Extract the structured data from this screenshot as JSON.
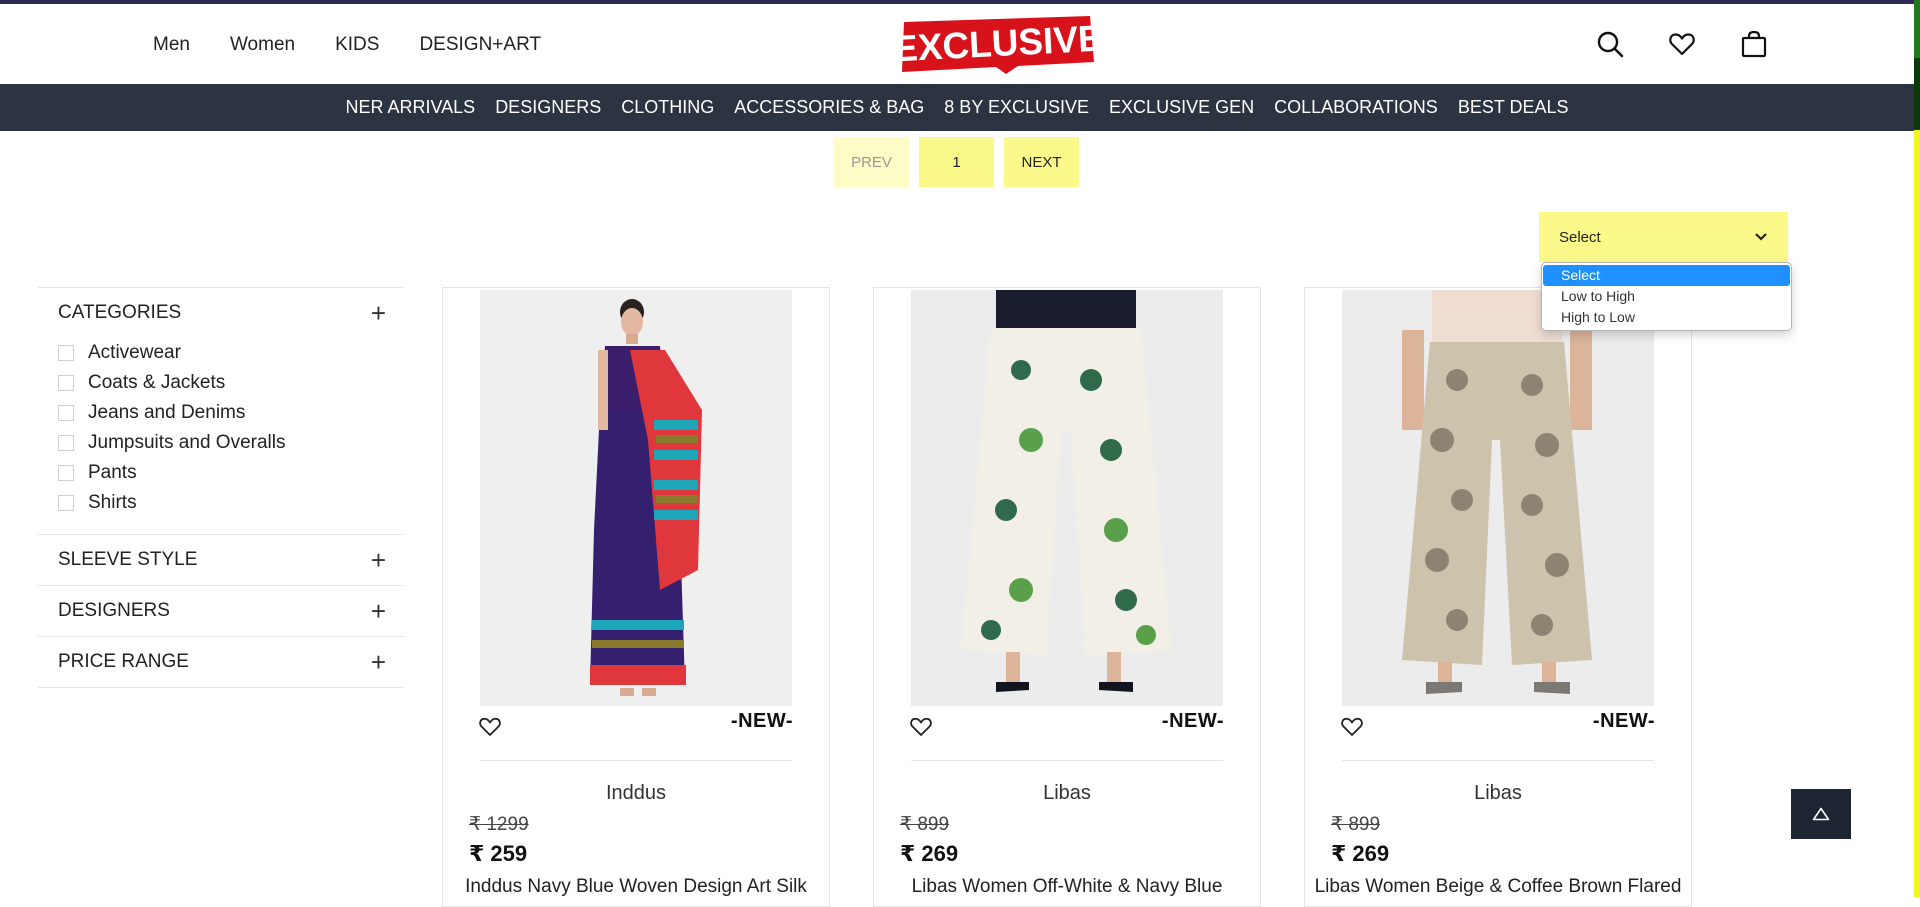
{
  "header": {
    "nav": [
      "Men",
      "Women",
      "KIDS",
      "DESIGN+ART"
    ],
    "logo_text": "EXCLUSIVE",
    "icons": [
      "search-icon",
      "heart-icon",
      "shopping-bag-icon"
    ]
  },
  "category_bar": [
    "NER ARRIVALS",
    "DESIGNERS",
    "CLOTHING",
    "ACCESSORIES & BAG",
    "8 BY EXCLUSIVE",
    "EXCLUSIVE GEN",
    "COLLABORATIONS",
    "BEST DEALS"
  ],
  "pagination": {
    "prev": "PREV",
    "current": "1",
    "next": "NEXT"
  },
  "sort": {
    "value": "Select",
    "options": [
      "Select",
      "Low to High",
      "High to Low"
    ],
    "selected_index": 0
  },
  "filters": {
    "categories": {
      "title": "CATEGORIES",
      "items": [
        "Activewear",
        "Coats & Jackets",
        "Jeans and Denims",
        "Jumpsuits and Overalls",
        "Pants",
        "Shirts"
      ]
    },
    "sleeve_style": {
      "title": "SLEEVE STYLE"
    },
    "designers": {
      "title": "DESIGNERS"
    },
    "price_range": {
      "title": "PRICE RANGE"
    }
  },
  "products": [
    {
      "tag": "-NEW-",
      "brand": "Inddus",
      "mrp": "₹ 1299",
      "price": "₹ 259",
      "title": "Inddus Navy Blue Woven Design Art Silk"
    },
    {
      "tag": "-NEW-",
      "brand": "Libas",
      "mrp": "₹ 899",
      "price": "₹ 269",
      "title": "Libas Women Off-White & Navy Blue"
    },
    {
      "tag": "-NEW-",
      "brand": "Libas",
      "mrp": "₹ 899",
      "price": "₹ 269",
      "title": "Libas Women Beige & Coffee Brown Flared"
    }
  ],
  "colors": {
    "top_strip": "#2e2a57",
    "category_bar": "#2c3341",
    "pager_yellow": "#fbf98a",
    "logo_red": "#d8121b",
    "dropdown_highlight": "#1e90ff"
  }
}
